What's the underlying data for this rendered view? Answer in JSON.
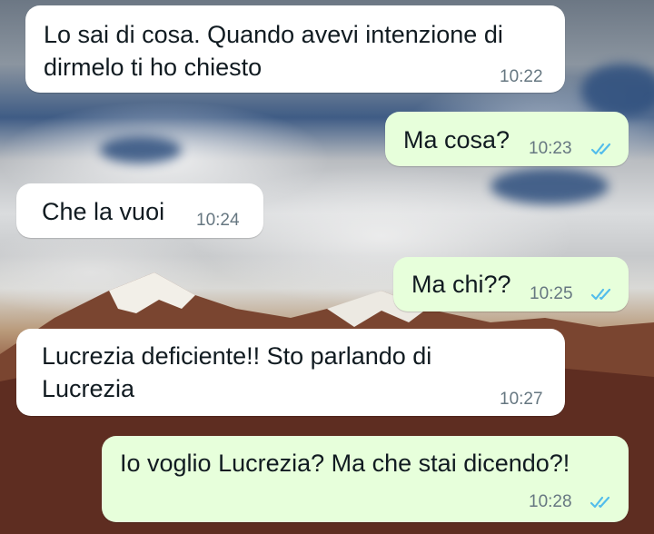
{
  "conversation": {
    "messages": [
      {
        "direction": "incoming",
        "lines": [
          "Lo sai di cosa. Quando avevi intenzione di",
          "dirmelo ti ho chiesto"
        ],
        "time": "10:22"
      },
      {
        "direction": "outgoing",
        "lines": [
          "Ma cosa?"
        ],
        "time": "10:23",
        "status": "read-double-check-icon"
      },
      {
        "direction": "incoming",
        "lines": [
          "Che la vuoi"
        ],
        "time": "10:24"
      },
      {
        "direction": "outgoing",
        "lines": [
          "Ma chi??"
        ],
        "time": "10:25",
        "status": "read-double-check-icon"
      },
      {
        "direction": "incoming",
        "lines": [
          "Lucrezia deficiente!! Sto parlando di",
          "Lucrezia"
        ],
        "time": "10:27"
      },
      {
        "direction": "outgoing",
        "lines": [
          "Io voglio Lucrezia? Ma che stai dicendo?!"
        ],
        "time": "10:28",
        "status": "read-double-check-icon"
      }
    ]
  },
  "colors": {
    "incoming_bubble": "#ffffff",
    "outgoing_bubble": "#e7ffdb",
    "read_ticks": "#53bdeb",
    "timestamp": "#667781"
  }
}
